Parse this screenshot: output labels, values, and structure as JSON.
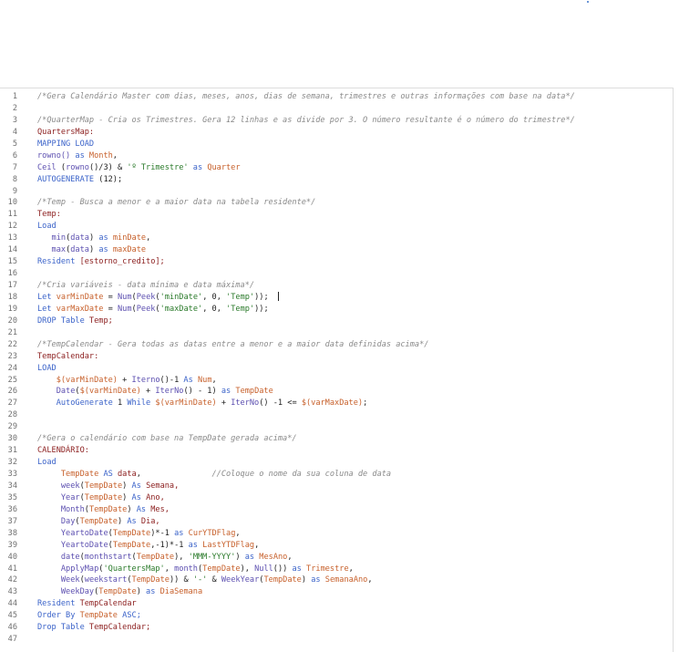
{
  "accent": "#3b63c9",
  "editor": {
    "lines": [
      {
        "n": "1",
        "tokens": [
          {
            "t": "/*Gera Calendário Master com dias, meses, anos, dias de semana, trimestres e outras informações com base na data*/",
            "c": "comment"
          }
        ]
      },
      {
        "n": "2",
        "tokens": []
      },
      {
        "n": "3",
        "tokens": [
          {
            "t": "/*QuarterMap - Cria os Trimestres. Gera 12 linhas e as divide por 3. O número resultante é o número do trimestre*/",
            "c": "comment"
          }
        ]
      },
      {
        "n": "4",
        "tokens": [
          {
            "t": "QuartersMap:",
            "c": "label"
          }
        ]
      },
      {
        "n": "5",
        "tokens": [
          {
            "t": "MAPPING LOAD",
            "c": "kw"
          }
        ]
      },
      {
        "n": "6",
        "tokens": [
          {
            "t": "rowno()",
            "c": "func"
          },
          {
            "t": " as ",
            "c": "kw"
          },
          {
            "t": "Month",
            "c": "fieldref"
          },
          {
            "t": ",",
            "c": "plain"
          }
        ]
      },
      {
        "n": "7",
        "tokens": [
          {
            "t": "Ceil",
            "c": "func"
          },
          {
            "t": " (",
            "c": "plain"
          },
          {
            "t": "rowno",
            "c": "func"
          },
          {
            "t": "()/3) & ",
            "c": "plain"
          },
          {
            "t": "'º Trimestre'",
            "c": "str"
          },
          {
            "t": " as ",
            "c": "kw"
          },
          {
            "t": "Quarter",
            "c": "fieldref"
          }
        ]
      },
      {
        "n": "8",
        "tokens": [
          {
            "t": "AUTOGENERATE",
            "c": "kw"
          },
          {
            "t": " (12);",
            "c": "plain"
          }
        ]
      },
      {
        "n": "9",
        "tokens": []
      },
      {
        "n": "10",
        "tokens": [
          {
            "t": "/*Temp - Busca a menor e a maior data na tabela residente*/",
            "c": "comment"
          }
        ]
      },
      {
        "n": "11",
        "tokens": [
          {
            "t": "Temp:",
            "c": "label"
          }
        ]
      },
      {
        "n": "12",
        "tokens": [
          {
            "t": "Load",
            "c": "kw"
          }
        ]
      },
      {
        "n": "13",
        "tokens": [
          {
            "t": "   ",
            "c": "plain"
          },
          {
            "t": "min",
            "c": "func"
          },
          {
            "t": "(",
            "c": "plain"
          },
          {
            "t": "data",
            "c": "func"
          },
          {
            "t": ")",
            "c": "plain"
          },
          {
            "t": " as ",
            "c": "kw"
          },
          {
            "t": "minDate",
            "c": "fieldref"
          },
          {
            "t": ",",
            "c": "plain"
          }
        ]
      },
      {
        "n": "14",
        "tokens": [
          {
            "t": "   ",
            "c": "plain"
          },
          {
            "t": "max",
            "c": "func"
          },
          {
            "t": "(",
            "c": "plain"
          },
          {
            "t": "data",
            "c": "func"
          },
          {
            "t": ")",
            "c": "plain"
          },
          {
            "t": " as ",
            "c": "kw"
          },
          {
            "t": "maxDate",
            "c": "fieldref"
          }
        ]
      },
      {
        "n": "15",
        "tokens": [
          {
            "t": "Resident",
            "c": "kw"
          },
          {
            "t": " [estorno_credito];",
            "c": "label"
          }
        ]
      },
      {
        "n": "16",
        "tokens": []
      },
      {
        "n": "17",
        "tokens": [
          {
            "t": "/*Cria variáveis - data mínima e data máxima*/",
            "c": "comment"
          }
        ]
      },
      {
        "n": "18",
        "tokens": [
          {
            "t": "Let",
            "c": "kw"
          },
          {
            "t": " ",
            "c": "plain"
          },
          {
            "t": "varMinDate",
            "c": "fieldref"
          },
          {
            "t": " = ",
            "c": "plain"
          },
          {
            "t": "Num",
            "c": "func"
          },
          {
            "t": "(",
            "c": "plain"
          },
          {
            "t": "Peek",
            "c": "func"
          },
          {
            "t": "(",
            "c": "plain"
          },
          {
            "t": "'minDate'",
            "c": "str"
          },
          {
            "t": ", 0, ",
            "c": "plain"
          },
          {
            "t": "'Temp'",
            "c": "str"
          },
          {
            "t": "));",
            "c": "plain"
          }
        ],
        "cursor": true
      },
      {
        "n": "19",
        "tokens": [
          {
            "t": "Let",
            "c": "kw"
          },
          {
            "t": " ",
            "c": "plain"
          },
          {
            "t": "varMaxDate",
            "c": "fieldref"
          },
          {
            "t": " = ",
            "c": "plain"
          },
          {
            "t": "Num",
            "c": "func"
          },
          {
            "t": "(",
            "c": "plain"
          },
          {
            "t": "Peek",
            "c": "func"
          },
          {
            "t": "(",
            "c": "plain"
          },
          {
            "t": "'maxDate'",
            "c": "str"
          },
          {
            "t": ", 0, ",
            "c": "plain"
          },
          {
            "t": "'Temp'",
            "c": "str"
          },
          {
            "t": "));",
            "c": "plain"
          }
        ]
      },
      {
        "n": "20",
        "tokens": [
          {
            "t": "DROP Table",
            "c": "kw"
          },
          {
            "t": " Temp;",
            "c": "label"
          }
        ]
      },
      {
        "n": "21",
        "tokens": []
      },
      {
        "n": "22",
        "tokens": [
          {
            "t": "/*TempCalendar - Gera todas as datas entre a menor e a maior data definidas acima*/",
            "c": "comment"
          }
        ]
      },
      {
        "n": "23",
        "tokens": [
          {
            "t": "TempCalendar:",
            "c": "label"
          }
        ]
      },
      {
        "n": "24",
        "tokens": [
          {
            "t": "LOAD",
            "c": "kw"
          }
        ]
      },
      {
        "n": "25",
        "tokens": [
          {
            "t": "    ",
            "c": "plain"
          },
          {
            "t": "$(varMinDate)",
            "c": "fieldref"
          },
          {
            "t": " + ",
            "c": "plain"
          },
          {
            "t": "Iterno",
            "c": "func"
          },
          {
            "t": "()-1 ",
            "c": "plain"
          },
          {
            "t": "As",
            "c": "kw"
          },
          {
            "t": " ",
            "c": "plain"
          },
          {
            "t": "Num",
            "c": "fieldref"
          },
          {
            "t": ",",
            "c": "plain"
          }
        ]
      },
      {
        "n": "26",
        "tokens": [
          {
            "t": "    ",
            "c": "plain"
          },
          {
            "t": "Date",
            "c": "func"
          },
          {
            "t": "(",
            "c": "plain"
          },
          {
            "t": "$(varMinDate)",
            "c": "fieldref"
          },
          {
            "t": " + ",
            "c": "plain"
          },
          {
            "t": "IterNo",
            "c": "func"
          },
          {
            "t": "() - 1) ",
            "c": "plain"
          },
          {
            "t": "as",
            "c": "kw"
          },
          {
            "t": " ",
            "c": "plain"
          },
          {
            "t": "TempDate",
            "c": "fieldref"
          }
        ]
      },
      {
        "n": "27",
        "tokens": [
          {
            "t": "    ",
            "c": "plain"
          },
          {
            "t": "AutoGenerate",
            "c": "kw"
          },
          {
            "t": " 1 ",
            "c": "plain"
          },
          {
            "t": "While",
            "c": "kw"
          },
          {
            "t": " ",
            "c": "plain"
          },
          {
            "t": "$(varMinDate)",
            "c": "fieldref"
          },
          {
            "t": " + ",
            "c": "plain"
          },
          {
            "t": "IterNo",
            "c": "func"
          },
          {
            "t": "() -1 <= ",
            "c": "plain"
          },
          {
            "t": "$(varMaxDate)",
            "c": "fieldref"
          },
          {
            "t": ";",
            "c": "plain"
          }
        ]
      },
      {
        "n": "28",
        "tokens": []
      },
      {
        "n": "29",
        "tokens": []
      },
      {
        "n": "30",
        "tokens": [
          {
            "t": "/*Gera o calendário com base na TempDate gerada acima*/",
            "c": "comment"
          }
        ]
      },
      {
        "n": "31",
        "tokens": [
          {
            "t": "CALENDÁRIO:",
            "c": "label"
          }
        ]
      },
      {
        "n": "32",
        "tokens": [
          {
            "t": "Load",
            "c": "kw"
          }
        ]
      },
      {
        "n": "33",
        "tokens": [
          {
            "t": "     ",
            "c": "plain"
          },
          {
            "t": "TempDate",
            "c": "fieldref"
          },
          {
            "t": " AS ",
            "c": "kw"
          },
          {
            "t": "data",
            "c": "label"
          },
          {
            "t": ",               ",
            "c": "plain"
          },
          {
            "t": "//Coloque o nome da sua coluna de data",
            "c": "comment"
          }
        ]
      },
      {
        "n": "34",
        "tokens": [
          {
            "t": "     ",
            "c": "plain"
          },
          {
            "t": "week",
            "c": "func"
          },
          {
            "t": "(",
            "c": "plain"
          },
          {
            "t": "TempDate",
            "c": "fieldref"
          },
          {
            "t": ") ",
            "c": "plain"
          },
          {
            "t": "As",
            "c": "kw"
          },
          {
            "t": " Semana,",
            "c": "label"
          }
        ]
      },
      {
        "n": "35",
        "tokens": [
          {
            "t": "     ",
            "c": "plain"
          },
          {
            "t": "Year",
            "c": "func"
          },
          {
            "t": "(",
            "c": "plain"
          },
          {
            "t": "TempDate",
            "c": "fieldref"
          },
          {
            "t": ") ",
            "c": "plain"
          },
          {
            "t": "As",
            "c": "kw"
          },
          {
            "t": " Ano,",
            "c": "label"
          }
        ]
      },
      {
        "n": "36",
        "tokens": [
          {
            "t": "     ",
            "c": "plain"
          },
          {
            "t": "Month",
            "c": "func"
          },
          {
            "t": "(",
            "c": "plain"
          },
          {
            "t": "TempDate",
            "c": "fieldref"
          },
          {
            "t": ") ",
            "c": "plain"
          },
          {
            "t": "As",
            "c": "kw"
          },
          {
            "t": " Mes,",
            "c": "label"
          }
        ]
      },
      {
        "n": "37",
        "tokens": [
          {
            "t": "     ",
            "c": "plain"
          },
          {
            "t": "Day",
            "c": "func"
          },
          {
            "t": "(",
            "c": "plain"
          },
          {
            "t": "TempDate",
            "c": "fieldref"
          },
          {
            "t": ") ",
            "c": "plain"
          },
          {
            "t": "As",
            "c": "kw"
          },
          {
            "t": " Dia,",
            "c": "label"
          }
        ]
      },
      {
        "n": "38",
        "tokens": [
          {
            "t": "     ",
            "c": "plain"
          },
          {
            "t": "YeartoDate",
            "c": "func"
          },
          {
            "t": "(",
            "c": "plain"
          },
          {
            "t": "TempDate",
            "c": "fieldref"
          },
          {
            "t": ")*-1 ",
            "c": "plain"
          },
          {
            "t": "as",
            "c": "kw"
          },
          {
            "t": " ",
            "c": "plain"
          },
          {
            "t": "CurYTDFlag",
            "c": "fieldref"
          },
          {
            "t": ",",
            "c": "plain"
          }
        ]
      },
      {
        "n": "39",
        "tokens": [
          {
            "t": "     ",
            "c": "plain"
          },
          {
            "t": "YeartoDate",
            "c": "func"
          },
          {
            "t": "(",
            "c": "plain"
          },
          {
            "t": "TempDate",
            "c": "fieldref"
          },
          {
            "t": ",-1)*-1 ",
            "c": "plain"
          },
          {
            "t": "as",
            "c": "kw"
          },
          {
            "t": " ",
            "c": "plain"
          },
          {
            "t": "LastYTDFlag",
            "c": "fieldref"
          },
          {
            "t": ",",
            "c": "plain"
          }
        ]
      },
      {
        "n": "40",
        "tokens": [
          {
            "t": "     ",
            "c": "plain"
          },
          {
            "t": "date",
            "c": "func"
          },
          {
            "t": "(",
            "c": "plain"
          },
          {
            "t": "monthstart",
            "c": "func"
          },
          {
            "t": "(",
            "c": "plain"
          },
          {
            "t": "TempDate",
            "c": "fieldref"
          },
          {
            "t": "), ",
            "c": "plain"
          },
          {
            "t": "'MMM-YYYY'",
            "c": "str"
          },
          {
            "t": ") ",
            "c": "plain"
          },
          {
            "t": "as",
            "c": "kw"
          },
          {
            "t": " ",
            "c": "plain"
          },
          {
            "t": "MesAno",
            "c": "fieldref"
          },
          {
            "t": ",",
            "c": "plain"
          }
        ]
      },
      {
        "n": "41",
        "tokens": [
          {
            "t": "     ",
            "c": "plain"
          },
          {
            "t": "ApplyMap",
            "c": "func"
          },
          {
            "t": "(",
            "c": "plain"
          },
          {
            "t": "'QuartersMap'",
            "c": "str"
          },
          {
            "t": ", ",
            "c": "plain"
          },
          {
            "t": "month",
            "c": "func"
          },
          {
            "t": "(",
            "c": "plain"
          },
          {
            "t": "TempDate",
            "c": "fieldref"
          },
          {
            "t": "), ",
            "c": "plain"
          },
          {
            "t": "Null",
            "c": "func"
          },
          {
            "t": "()) ",
            "c": "plain"
          },
          {
            "t": "as",
            "c": "kw"
          },
          {
            "t": " ",
            "c": "plain"
          },
          {
            "t": "Trimestre",
            "c": "fieldref"
          },
          {
            "t": ",",
            "c": "plain"
          }
        ]
      },
      {
        "n": "42",
        "tokens": [
          {
            "t": "     ",
            "c": "plain"
          },
          {
            "t": "Week",
            "c": "func"
          },
          {
            "t": "(",
            "c": "plain"
          },
          {
            "t": "weekstart",
            "c": "func"
          },
          {
            "t": "(",
            "c": "plain"
          },
          {
            "t": "TempDate",
            "c": "fieldref"
          },
          {
            "t": ")) & ",
            "c": "plain"
          },
          {
            "t": "'-'",
            "c": "str"
          },
          {
            "t": " & ",
            "c": "plain"
          },
          {
            "t": "WeekYear",
            "c": "func"
          },
          {
            "t": "(",
            "c": "plain"
          },
          {
            "t": "TempDate",
            "c": "fieldref"
          },
          {
            "t": ") ",
            "c": "plain"
          },
          {
            "t": "as",
            "c": "kw"
          },
          {
            "t": " ",
            "c": "plain"
          },
          {
            "t": "SemanaAno",
            "c": "fieldref"
          },
          {
            "t": ",",
            "c": "plain"
          }
        ]
      },
      {
        "n": "43",
        "tokens": [
          {
            "t": "     ",
            "c": "plain"
          },
          {
            "t": "WeekDay",
            "c": "func"
          },
          {
            "t": "(",
            "c": "plain"
          },
          {
            "t": "TempDate",
            "c": "fieldref"
          },
          {
            "t": ") ",
            "c": "plain"
          },
          {
            "t": "as",
            "c": "kw"
          },
          {
            "t": " ",
            "c": "plain"
          },
          {
            "t": "DiaSemana",
            "c": "fieldref"
          }
        ]
      },
      {
        "n": "44",
        "tokens": [
          {
            "t": "Resident",
            "c": "kw"
          },
          {
            "t": " TempCalendar",
            "c": "label"
          }
        ]
      },
      {
        "n": "45",
        "tokens": [
          {
            "t": "Order By",
            "c": "kw"
          },
          {
            "t": " ",
            "c": "plain"
          },
          {
            "t": "TempDate",
            "c": "fieldref"
          },
          {
            "t": " ASC;",
            "c": "kw"
          }
        ]
      },
      {
        "n": "46",
        "tokens": [
          {
            "t": "Drop Table",
            "c": "kw"
          },
          {
            "t": " TempCalendar;",
            "c": "label"
          }
        ]
      },
      {
        "n": "47",
        "tokens": []
      }
    ]
  }
}
